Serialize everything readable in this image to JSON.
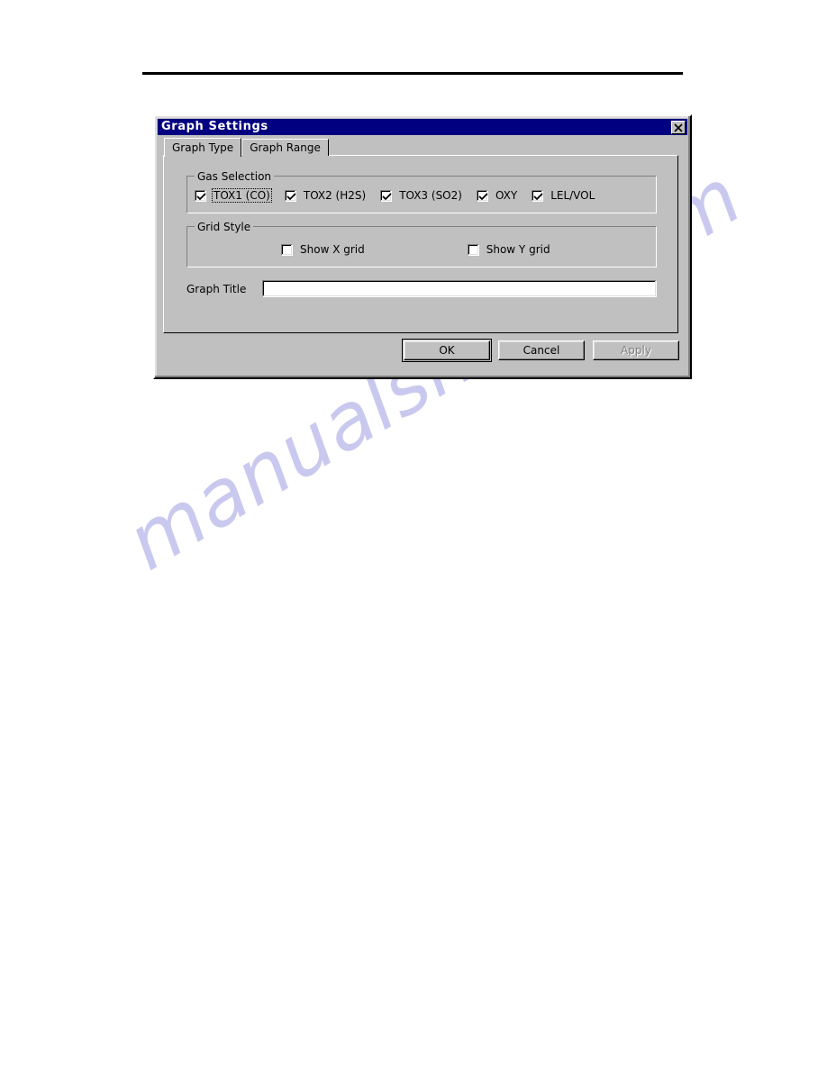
{
  "page": {
    "rule": "horizontal-rule",
    "watermark": "manualshive.com",
    "watermark_color": "#c9c9ef"
  },
  "dialog": {
    "title": "Graph Settings",
    "titlebar_color": "#000080",
    "face_color": "#c0c0c0",
    "close_icon": "close-icon",
    "tabs": [
      {
        "label": "Graph Type",
        "active": true
      },
      {
        "label": "Graph Range",
        "active": false
      }
    ],
    "gas_selection": {
      "legend": "Gas Selection",
      "items": [
        {
          "label": "TOX1 (CO)",
          "checked": true,
          "focused": true
        },
        {
          "label": "TOX2 (H2S)",
          "checked": true,
          "focused": false
        },
        {
          "label": "TOX3 (SO2)",
          "checked": true,
          "focused": false
        },
        {
          "label": "OXY",
          "checked": true,
          "focused": false
        },
        {
          "label": "LEL/VOL",
          "checked": true,
          "focused": false
        }
      ]
    },
    "grid_style": {
      "legend": "Grid Style",
      "items": [
        {
          "label": "Show X grid",
          "checked": false
        },
        {
          "label": "Show Y grid",
          "checked": false
        }
      ]
    },
    "graph_title": {
      "label": "Graph Title",
      "value": "",
      "placeholder": ""
    },
    "buttons": [
      {
        "label": "OK",
        "default": true,
        "disabled": false
      },
      {
        "label": "Cancel",
        "default": false,
        "disabled": false
      },
      {
        "label": "Apply",
        "default": false,
        "disabled": true
      }
    ]
  }
}
